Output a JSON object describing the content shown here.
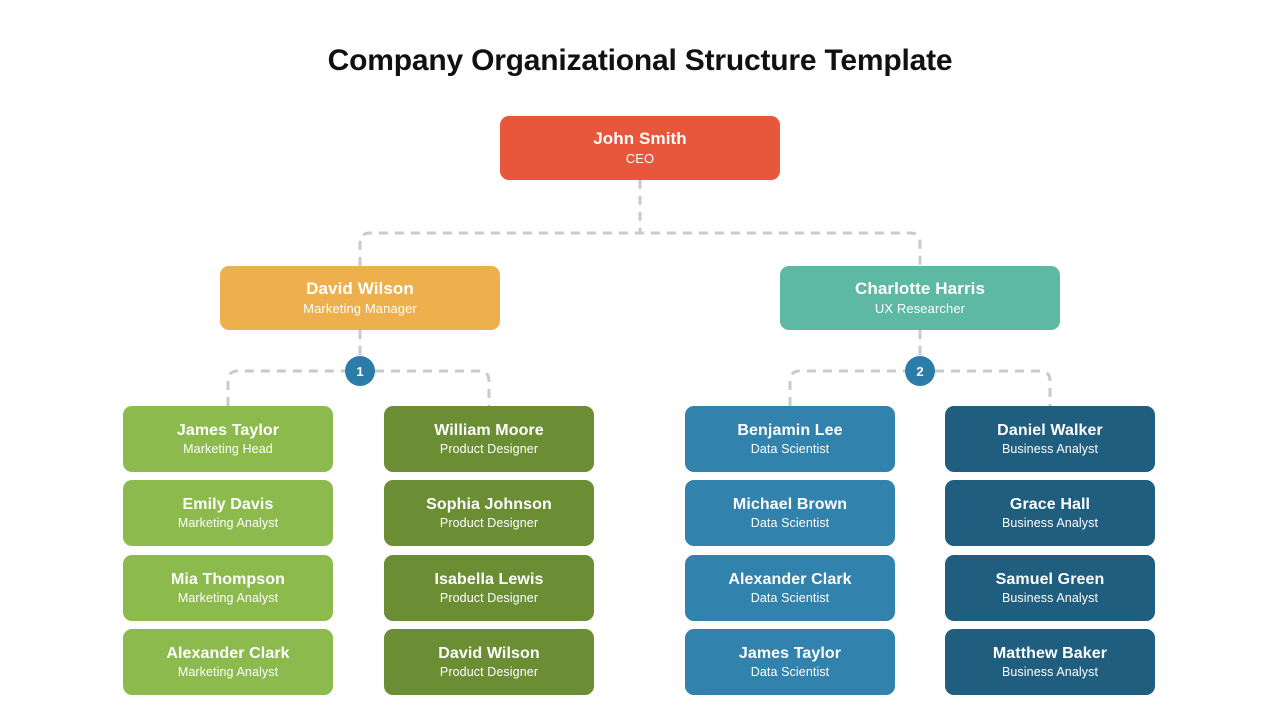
{
  "title": "Company Organizational Structure Template",
  "colors": {
    "root": "#E8573C",
    "manager_0": "#EDB04C",
    "manager_1": "#5DB9A4",
    "column_0": "#8CBA4D",
    "column_1": "#6B8E35",
    "column_2": "#3182AC",
    "column_3": "#1F5E7E",
    "badge": "#2B7CA8",
    "connector": "#C9CACB",
    "title_text": "#111111",
    "node_text": "#FFFFFF",
    "background": "#FFFFFF"
  },
  "chart_data": {
    "type": "org-chart",
    "title": "Company Organizational Structure Template",
    "root": {
      "name": "John Smith",
      "role": "CEO"
    },
    "branches": [
      {
        "badge": "1",
        "manager": {
          "name": "David Wilson",
          "role": "Marketing Manager"
        },
        "columns": [
          {
            "members": [
              {
                "name": "James Taylor",
                "role": "Marketing Head"
              },
              {
                "name": "Emily Davis",
                "role": "Marketing Analyst"
              },
              {
                "name": "Mia Thompson",
                "role": "Marketing Analyst"
              },
              {
                "name": "Alexander Clark",
                "role": "Marketing Analyst"
              }
            ]
          },
          {
            "members": [
              {
                "name": "William Moore",
                "role": "Product Designer"
              },
              {
                "name": "Sophia Johnson",
                "role": "Product Designer"
              },
              {
                "name": "Isabella Lewis",
                "role": "Product Designer"
              },
              {
                "name": "David Wilson",
                "role": "Product Designer"
              }
            ]
          }
        ]
      },
      {
        "badge": "2",
        "manager": {
          "name": "Charlotte Harris",
          "role": "UX Researcher"
        },
        "columns": [
          {
            "members": [
              {
                "name": "Benjamin Lee",
                "role": "Data Scientist"
              },
              {
                "name": "Michael Brown",
                "role": "Data Scientist"
              },
              {
                "name": "Alexander Clark",
                "role": "Data Scientist"
              },
              {
                "name": "James Taylor",
                "role": "Data Scientist"
              }
            ]
          },
          {
            "members": [
              {
                "name": "Daniel Walker",
                "role": "Business Analyst"
              },
              {
                "name": "Grace Hall",
                "role": "Business Analyst"
              },
              {
                "name": "Samuel Green",
                "role": "Business Analyst"
              },
              {
                "name": "Matthew Baker",
                "role": "Business Analyst"
              }
            ]
          }
        ]
      }
    ]
  }
}
